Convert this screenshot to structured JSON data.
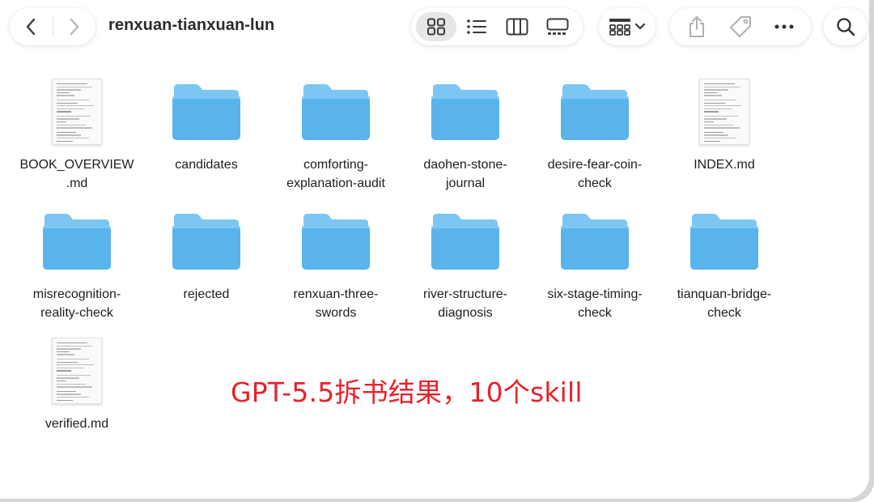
{
  "window": {
    "title": "renxuan-tianxuan-lun"
  },
  "toolbar": {
    "back_icon": "chevron-left-icon",
    "forward_icon": "chevron-right-icon",
    "views": [
      {
        "name": "icon-view",
        "icon": "grid-icon",
        "active": true
      },
      {
        "name": "list-view",
        "icon": "list-icon",
        "active": false
      },
      {
        "name": "column-view",
        "icon": "columns-icon",
        "active": false
      },
      {
        "name": "gallery-view",
        "icon": "gallery-icon",
        "active": false
      }
    ],
    "group_icon": "group-by-icon",
    "share_icon": "share-icon",
    "tag_icon": "tag-icon",
    "more_icon": "ellipsis-icon",
    "search_icon": "search-icon"
  },
  "files": [
    {
      "label": "BOOK_OVERVIEW\n.md",
      "kind": "document"
    },
    {
      "label": "candidates",
      "kind": "folder"
    },
    {
      "label": "comforting-\nexplanation-audit",
      "kind": "folder"
    },
    {
      "label": "daohen-stone-\njournal",
      "kind": "folder"
    },
    {
      "label": "desire-fear-coin-\ncheck",
      "kind": "folder"
    },
    {
      "label": "INDEX.md",
      "kind": "document"
    },
    {
      "label": "misrecognition-\nreality-check",
      "kind": "folder"
    },
    {
      "label": "rejected",
      "kind": "folder"
    },
    {
      "label": "renxuan-three-\nswords",
      "kind": "folder"
    },
    {
      "label": "river-structure-\ndiagnosis",
      "kind": "folder"
    },
    {
      "label": "six-stage-timing-\ncheck",
      "kind": "folder"
    },
    {
      "label": "tianquan-bridge-\ncheck",
      "kind": "folder"
    },
    {
      "label": "verified.md",
      "kind": "document"
    }
  ],
  "annotation": {
    "text": "GPT-5.5拆书结果，10个skill",
    "color": "#e8212b"
  },
  "colors": {
    "folder_body": "#5ab4ec",
    "folder_tab": "#7cc6f3",
    "accent_red": "#e8212b"
  }
}
